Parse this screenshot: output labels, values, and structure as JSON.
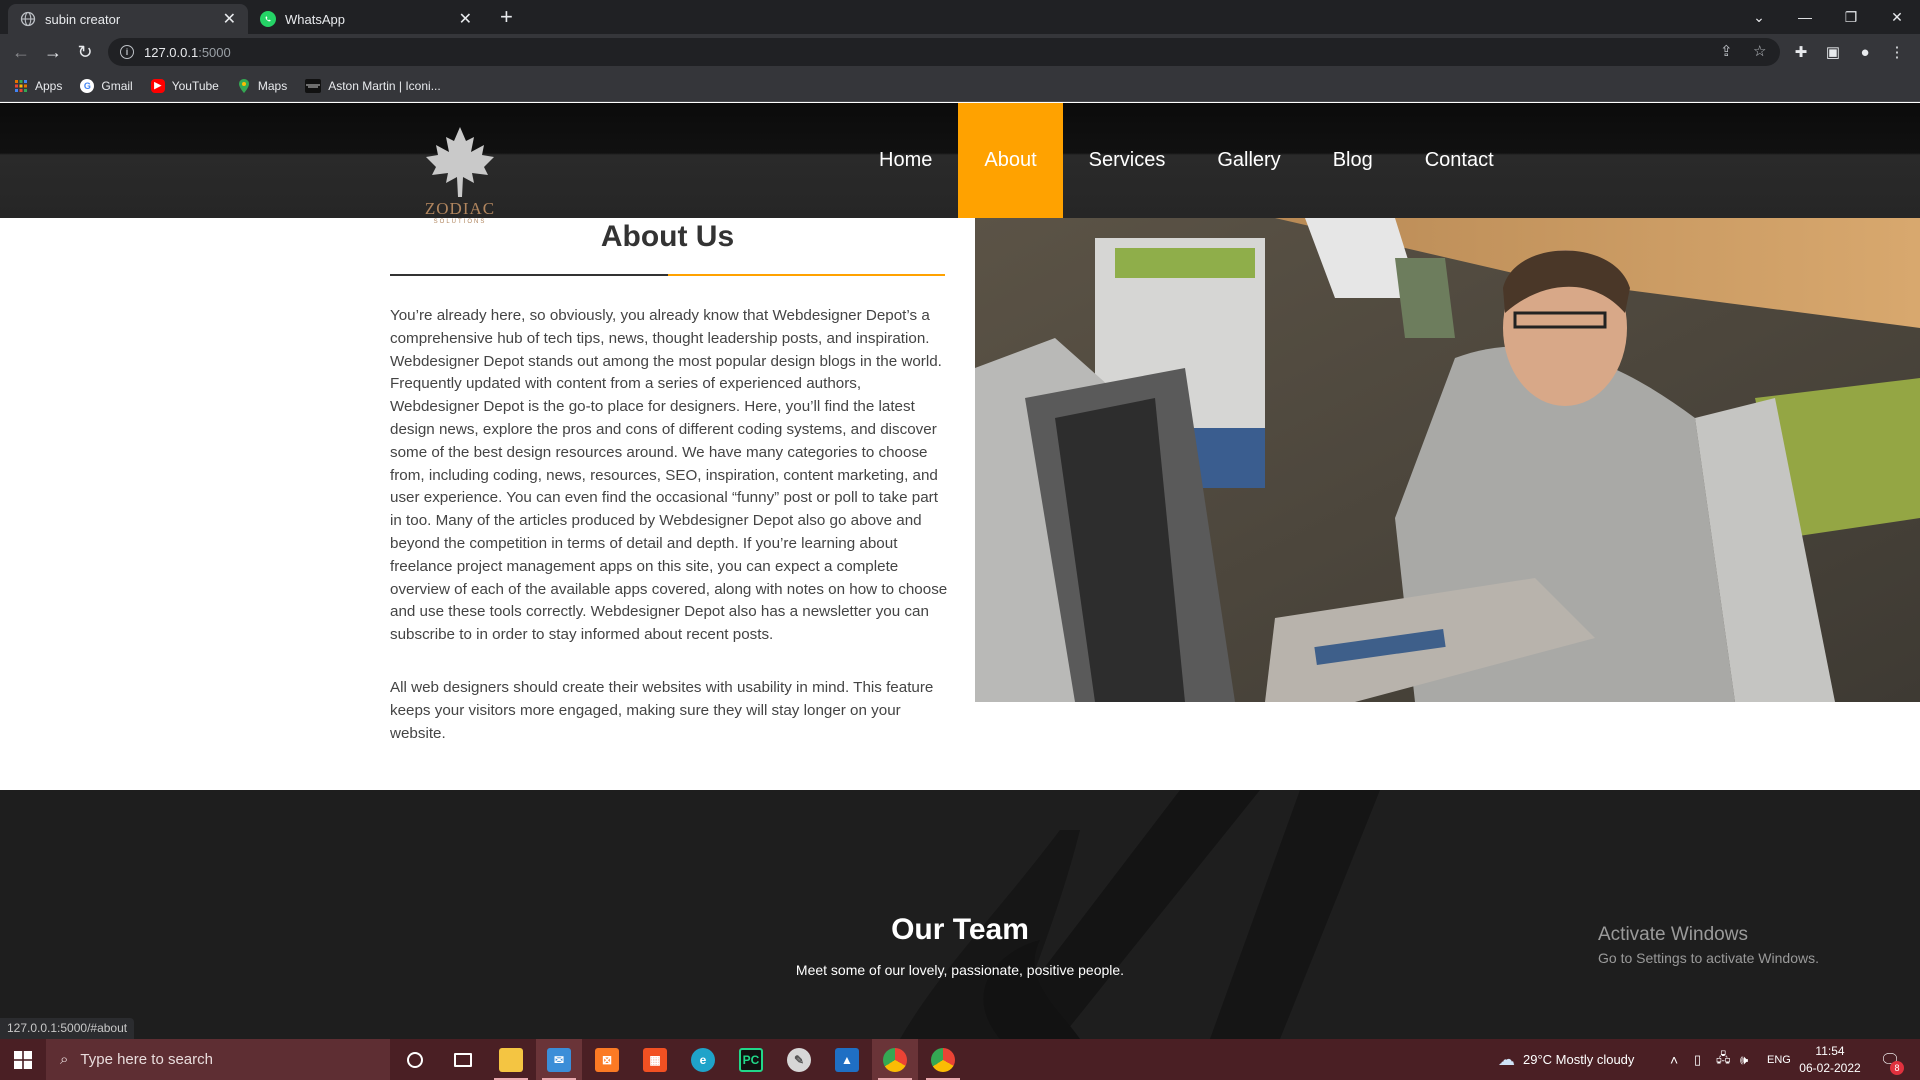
{
  "browser": {
    "tabs": [
      {
        "title": "subin creator",
        "active": true,
        "favicon": "globe-icon"
      },
      {
        "title": "WhatsApp",
        "active": false,
        "favicon": "whatsapp-icon"
      }
    ],
    "url_host": "127.0.0.1",
    "url_port": ":5000",
    "bookmarks": [
      {
        "label": "Apps",
        "icon": "apps-grid-icon"
      },
      {
        "label": "Gmail",
        "icon": "google-icon"
      },
      {
        "label": "YouTube",
        "icon": "youtube-icon"
      },
      {
        "label": "Maps",
        "icon": "maps-icon"
      },
      {
        "label": "Aston Martin | Iconi...",
        "icon": "aston-martin-icon"
      }
    ],
    "status_url": "127.0.0.1:5000/#about"
  },
  "site": {
    "logo": {
      "brand": "ZODIAC",
      "tagline": "SOLUTIONS"
    },
    "nav": [
      "Home",
      "About",
      "Services",
      "Gallery",
      "Blog",
      "Contact"
    ],
    "active_nav": "About",
    "accent_color": "#ffa200",
    "about": {
      "title": "About Us",
      "paragraphs": [
        "You’re already here, so obviously, you already know that Webdesigner Depot’s a comprehensive hub of tech tips, news, thought leadership posts, and inspiration. Webdesigner Depot stands out among the most popular design blogs in the world. Frequently updated with content from a series of experienced authors, Webdesigner Depot is the go-to place for designers. Here, you’ll find the latest design news, explore the pros and cons of different coding systems, and discover some of the best design resources around. We have many categories to choose from, including coding, news, resources, SEO, inspiration, content marketing, and user experience. You can even find the occasional “funny” post or poll to take part in too. Many of the articles produced by Webdesigner Depot also go above and beyond the competition in terms of detail and depth. If you’re learning about freelance project management apps on this site, you can expect a complete overview of each of the available apps covered, along with notes on how to choose and use these tools correctly. Webdesigner Depot also has a newsletter you can subscribe to in order to stay informed about recent posts.",
        "All web designers should create their websites with usability in mind. This feature keeps your visitors more engaged, making sure they will stay longer on your website."
      ]
    },
    "team": {
      "title": "Our Team",
      "lead": "Meet some of our lovely, passionate, positive people."
    }
  },
  "windows": {
    "activate_title": "Activate Windows",
    "activate_sub": "Go to Settings to activate Windows.",
    "search_placeholder": "Type here to search",
    "weather": "29°C  Mostly cloudy",
    "language": "ENG",
    "time": "11:54",
    "date": "06-02-2022",
    "notification_count": "8"
  }
}
